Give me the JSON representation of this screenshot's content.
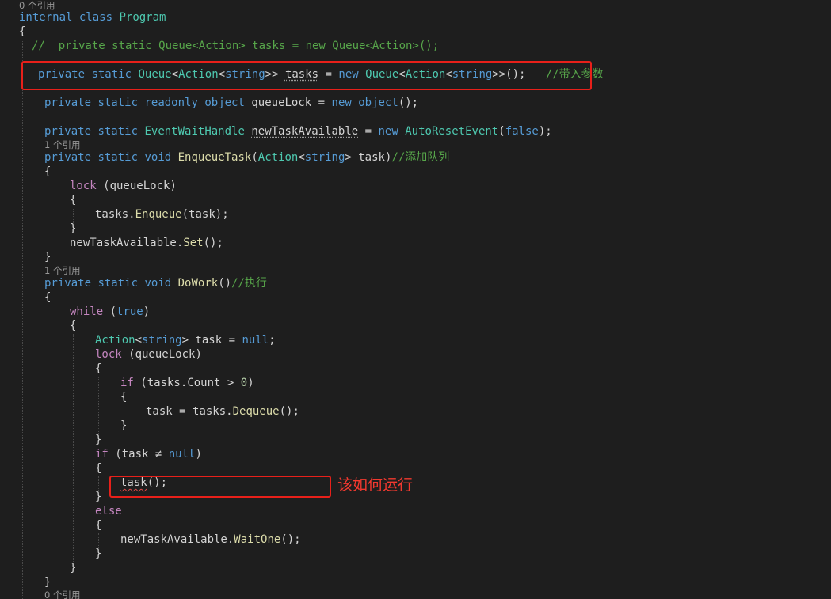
{
  "codelens": {
    "zero_refs": "0 个引用",
    "one_ref": "1 个引用"
  },
  "code": {
    "kw_internal": "internal",
    "kw_class": "class",
    "kw_private": "private",
    "kw_static": "static",
    "kw_readonly": "readonly",
    "kw_object": "object",
    "kw_new": "new",
    "kw_void": "void",
    "kw_string": "string",
    "kw_false": "false",
    "kw_true": "true",
    "kw_null": "null",
    "kw_lock": "lock",
    "kw_while": "while",
    "kw_if": "if",
    "kw_else": "else",
    "class_name": "Program",
    "type_queue": "Queue",
    "type_action": "Action",
    "type_ewh": "EventWaitHandle",
    "type_are": "AutoResetEvent",
    "fn_enqueue_task": "EnqueueTask",
    "fn_do_work": "DoWork",
    "fn_enqueue": "Enqueue",
    "fn_dequeue": "Dequeue",
    "fn_set": "Set",
    "fn_wait_one": "WaitOne",
    "var_tasks": "tasks",
    "var_task": "task",
    "var_queue_lock": "queueLock",
    "var_new_task_available": "newTaskAvailable",
    "prop_count": "Count",
    "num_zero": "0",
    "commented_line": "//  private static Queue<Action> tasks = new Queue<Action>();",
    "comment_with_param": "//带入参数",
    "comment_add_queue": "//添加队列",
    "comment_execute": "//执行"
  },
  "annotations": {
    "how_to_run": "该如何运行"
  },
  "colors": {
    "background": "#1e1e1e",
    "keyword": "#569cd6",
    "control_keyword": "#c586c0",
    "type": "#4ec9b0",
    "method": "#dcdcaa",
    "comment": "#57a64a",
    "plain": "#d4d4d4",
    "number": "#b5cea8",
    "annotation_red": "#e8201a"
  }
}
